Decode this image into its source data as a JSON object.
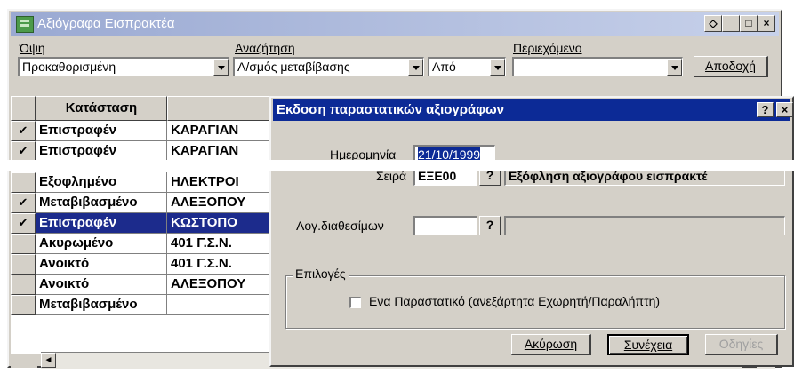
{
  "window": {
    "title": "Αξιόγραφα Εισπρακτέα",
    "buttons": [
      "◇",
      "_",
      "□",
      "×"
    ]
  },
  "filters": {
    "view_label": "Όψη",
    "view_value": "Προκαθορισμένη",
    "search_label": "Αναζήτηση",
    "search_value": "Α/σμός μεταβίβασης",
    "search_op_value": "Από",
    "content_label": "Περιεχόμενο",
    "content_value": "",
    "accept_button": "Αποδοχή"
  },
  "grid": {
    "column_header": "Κατάσταση",
    "rows": [
      {
        "check": "✔",
        "status": "Επιστραφέν",
        "name": "ΚΑΡΑΓΙΑΝ"
      },
      {
        "check": "✔",
        "status": "Επιστραφέν",
        "name": "ΚΑΡΑΓΙΑΝ"
      },
      {
        "check": "",
        "status": "Εξοφλημένο",
        "name": "ΗΛΕΚΤΡΟΙ"
      },
      {
        "check": "✔",
        "status": "Μεταβιβασμένο",
        "name": "ΑΛΕΞΟΠΟΥ"
      },
      {
        "check": "✔",
        "status": "Επιστραφέν",
        "name": "ΚΩΣΤΟΠΟ"
      },
      {
        "check": "",
        "status": "Ακυρωμένο",
        "name": "401 Γ.Σ.Ν."
      },
      {
        "check": "",
        "status": "Ανοικτό",
        "name": "401 Γ.Σ.Ν."
      },
      {
        "check": "",
        "status": "Ανοικτό",
        "name": "ΑΛΕΞΟΠΟΥ"
      },
      {
        "check": "",
        "status": "Μεταβιβασμένο",
        "name": ""
      }
    ]
  },
  "dialog": {
    "title": "Εκδοση παραστατικών αξιογράφων",
    "help_button": "?",
    "close_button": "×",
    "date_label": "Ημερομηνία",
    "date_value": "21/10/1999",
    "series_label": "Σειρά",
    "series_value": "ΕΞΕ00",
    "series_desc": "Εξόφληση αξιογράφου εισπρακτέ",
    "availability_label": "Λογ.διαθεσίμων",
    "availability_value": "",
    "lookup_label": "?",
    "options_title": "Επιλογές",
    "single_doc_label": "Ενα Παραστατικό (ανεξάρτητα Εχωρητή/Παραλήπτη)",
    "cancel_button": "Ακύρωση",
    "continue_button": "Συνέχεια",
    "instructions_button": "Οδηγίες"
  },
  "colors": {
    "selection": "#1c2b8c",
    "dialog_title_bg": "#0c2a96",
    "window_title_bg": "#9aa9d2"
  }
}
